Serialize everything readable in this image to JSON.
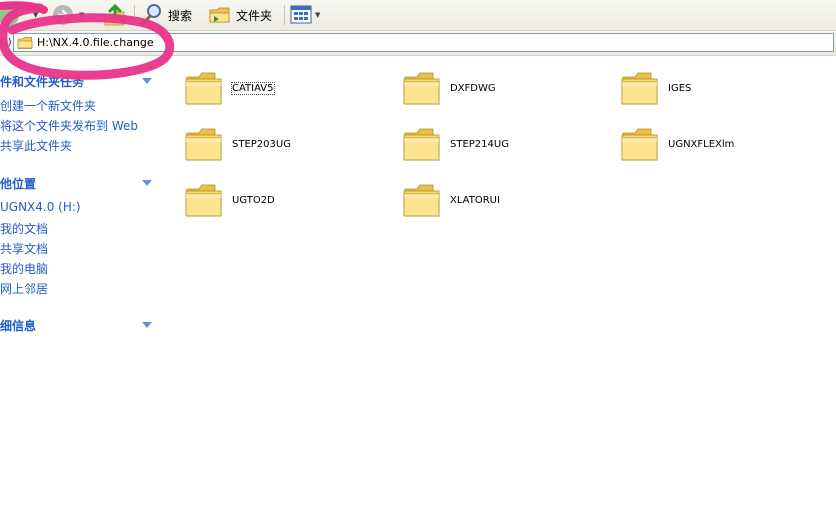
{
  "toolbar": {
    "search_label": "搜索",
    "folders_label": "文件夹"
  },
  "addressbar": {
    "label": "D)",
    "path": "H:\\NX.4.0.file.change"
  },
  "taskpane": {
    "groups": [
      {
        "title": "件和文件夹任务",
        "items": [
          "创建一个新文件夹",
          "将这个文件夹发布到 Web",
          "共享此文件夹"
        ]
      },
      {
        "title": "他位置",
        "items": [
          "UGNX4.0 (H:)",
          "我的文档",
          "共享文档",
          "我的电脑",
          "网上邻居"
        ]
      },
      {
        "title": "细信息",
        "items": []
      }
    ]
  },
  "files": [
    {
      "name": "CATIAV5"
    },
    {
      "name": "DXFDWG"
    },
    {
      "name": "IGES"
    },
    {
      "name": "STEP203UG"
    },
    {
      "name": "STEP214UG"
    },
    {
      "name": "UGNXFLEXlm"
    },
    {
      "name": "UGTO2D"
    },
    {
      "name": "XLATORUI"
    }
  ],
  "colors": {
    "annotation": "#e8358a",
    "link": "#215dc6",
    "folder": "#f6d66b"
  }
}
